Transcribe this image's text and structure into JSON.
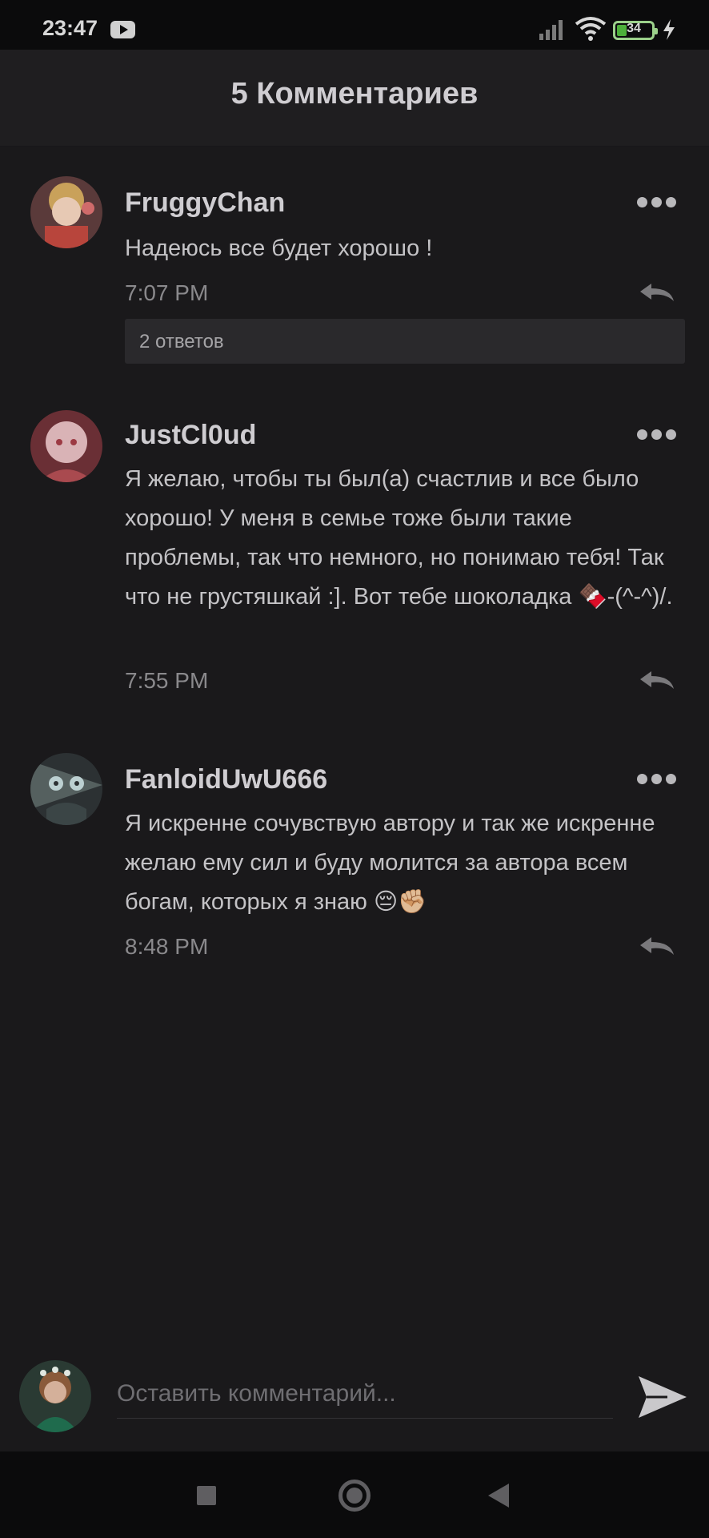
{
  "status_bar": {
    "time": "23:47",
    "battery": "34",
    "icons": [
      "youtube-icon",
      "signal-icon",
      "wifi-icon",
      "battery-icon",
      "charging-icon"
    ]
  },
  "header": {
    "title": "5 Комментариев"
  },
  "comments": [
    {
      "username": "FruggyChan",
      "text": "Надеюсь все будет хорошо !",
      "time": "7:07 PM",
      "replies": "2 ответов"
    },
    {
      "username": "JustCl0ud",
      "text": "Я желаю, чтобы ты был(а) счастлив и все было хорошо! У меня в семье тоже были такие проблемы, так что немного, но понимаю тебя! Так что не грустяшкай :]. Вот тебе шоколадка 🍫-(^-^)/.",
      "time": "7:55 PM"
    },
    {
      "username": "FanloidUwU666",
      "text": "Я искренне сочувствую автору и так же искренне желаю ему сил и буду молится за автора всем богам, которых я знаю 😔✊🏼",
      "time": "8:48 PM"
    }
  ],
  "composer": {
    "placeholder": "Оставить комментарий..."
  },
  "colors": {
    "background": "#1a191b",
    "header": "#1f1e20",
    "text": "#c4c3c6",
    "muted": "#8a898c"
  }
}
